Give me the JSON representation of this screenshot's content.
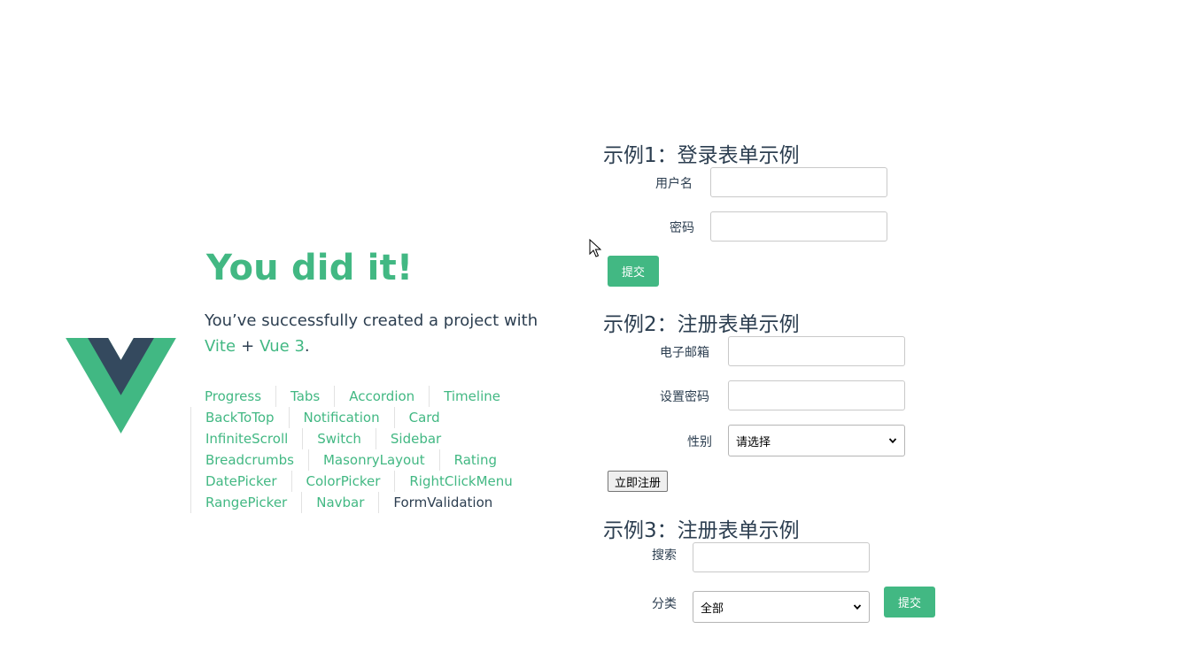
{
  "hero": {
    "title": "You did it!",
    "subtitle_prefix": "You’ve successfully created a project with",
    "vite_link": "Vite",
    "plus": "+",
    "vue_link": "Vue 3",
    "period": "."
  },
  "nav": {
    "rows": [
      [
        "Progress",
        "Tabs",
        "Accordion",
        "Timeline"
      ],
      [
        "BackToTop",
        "Notification",
        "Card"
      ],
      [
        "InfiniteScroll",
        "Switch",
        "Sidebar"
      ],
      [
        "Breadcrumbs",
        "MasonryLayout",
        "Rating"
      ],
      [
        "DatePicker",
        "ColorPicker",
        "RightClickMenu"
      ],
      [
        "RangePicker",
        "Navbar",
        "FormValidation"
      ]
    ],
    "active": "FormValidation"
  },
  "form1": {
    "title": "示例1：登录表单示例",
    "username_label": "用户名",
    "username_value": "",
    "password_label": "密码",
    "password_value": "",
    "submit_label": "提交"
  },
  "form2": {
    "title": "示例2：注册表单示例",
    "email_label": "电子邮箱",
    "email_value": "",
    "password_label": "设置密码",
    "password_value": "",
    "gender_label": "性别",
    "gender_selected": "请选择",
    "register_label": "立即注册"
  },
  "form3": {
    "title": "示例3：注册表单示例",
    "search_label": "搜索",
    "search_value": "",
    "category_label": "分类",
    "category_selected": "全部",
    "submit_label": "提交"
  },
  "colors": {
    "accent": "#42b883",
    "text": "#2c3e50",
    "logo_dark": "#35495e"
  },
  "icons": {
    "logo": "vue-logo",
    "select_arrow": "chevron-down-icon",
    "pointer": "mouse-cursor-icon"
  }
}
